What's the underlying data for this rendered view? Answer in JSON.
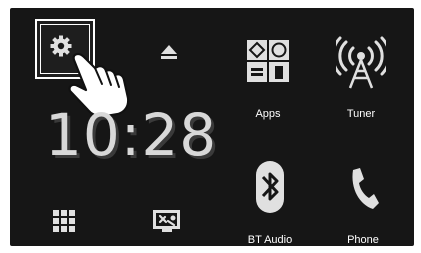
{
  "colors": {
    "screen_bg": "#161616",
    "icon_light": "#e0e0e0",
    "icon_dark": "#161616",
    "accent_white": "#ffffff"
  },
  "clock": {
    "time": "10:28"
  },
  "left_controls": [
    {
      "icon": "gear-icon"
    },
    {
      "icon": "eject-icon"
    },
    {
      "icon": "grid-menu-icon"
    },
    {
      "icon": "screen-adjust-icon"
    }
  ],
  "apps": [
    {
      "label": "Apps",
      "icon": "apps-icon"
    },
    {
      "label": "Tuner",
      "icon": "antenna-icon"
    },
    {
      "label": "BT Audio",
      "icon": "bluetooth-icon"
    },
    {
      "label": "Phone",
      "icon": "phone-icon"
    }
  ],
  "overlay": {
    "icon": "pointing-hand-icon"
  }
}
